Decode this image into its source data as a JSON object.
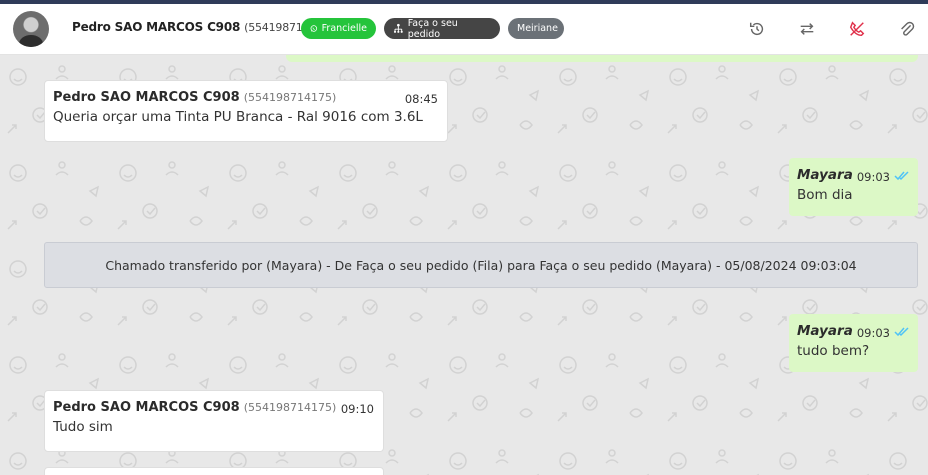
{
  "header": {
    "contact_name": "Pedro SAO MARCOS C908",
    "contact_number": "(554198714175)",
    "tags": [
      {
        "label": "Francielle",
        "color": "#25c43b",
        "icon": "whatsapp-icon"
      },
      {
        "label": "Faça o seu pedido",
        "color": "#454545",
        "icon": "queue-icon"
      },
      {
        "label": "Meiriane",
        "color": "#6b7177"
      }
    ],
    "actions": [
      "history-icon",
      "transfer-icon",
      "end-call-icon",
      "attach-icon"
    ]
  },
  "messages": [
    {
      "type": "incoming",
      "sender": "Pedro SAO MARCOS C908",
      "number": "(554198714175)",
      "time": "08:45",
      "text": "Queria orçar uma Tinta PU Branca - Ral 9016 com 3.6L"
    },
    {
      "type": "outgoing",
      "sender": "Mayara",
      "time": "09:03",
      "text": "Bom dia"
    },
    {
      "type": "system",
      "text": "Chamado transferido por (Mayara) - De Faça o seu pedido (Fila) para Faça o seu pedido (Mayara) - 05/08/2024 09:03:04"
    },
    {
      "type": "outgoing",
      "sender": "Mayara",
      "time": "09:03",
      "text": "tudo bem?"
    },
    {
      "type": "incoming",
      "sender": "Pedro SAO MARCOS C908",
      "number": "(554198714175)",
      "time": "09:10",
      "text": "Tudo sim"
    }
  ],
  "colors": {
    "accent_green": "#25c43b",
    "outgoing_bubble": "#dcf8c6",
    "end_call_red": "#e0314b",
    "read_check": "#4fc3f7"
  }
}
